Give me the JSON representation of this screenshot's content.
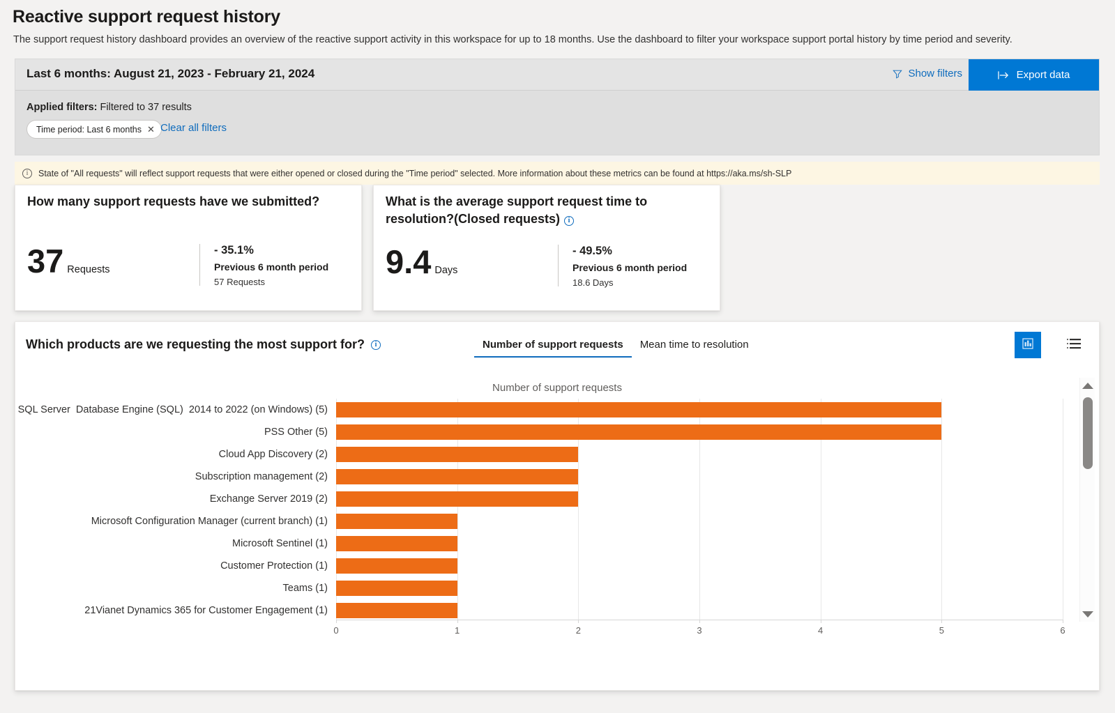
{
  "header": {
    "title": "Reactive support request history",
    "description": "The support request history dashboard provides an overview of the reactive support activity in this workspace for up to 18 months. Use the dashboard to filter your workspace support portal history by time period and severity."
  },
  "filter_panel": {
    "range_label": "Last 6 months: August 21, 2023 - February 21, 2024",
    "show_filters_label": "Show filters",
    "show_filters_icon": "funnel-icon",
    "export_label": "Export data",
    "export_icon": "export-arrow-icon",
    "applied_filters_label": "Applied filters:",
    "applied_filters_value": " Filtered to 37 results",
    "chip_label": "Time period: Last 6 months",
    "chip_close_icon": "close-icon",
    "clear_all_label": "Clear all filters"
  },
  "banner": {
    "icon": "info-icon",
    "text": "State of \"All requests\" will reflect support requests that were either opened or closed during the \"Time period\" selected. More information about these metrics can be found at https://aka.ms/sh-SLP"
  },
  "kpis": [
    {
      "title": "How many support requests have we submitted?",
      "value": "37",
      "unit": "Requests",
      "delta": "- 35.1%",
      "previous_label": "Previous 6 month period",
      "previous_value": "57 Requests",
      "has_info_icon": false
    },
    {
      "title_line1": "What is the average support request time to",
      "title_line2": "resolution?(Closed requests)",
      "value": "9.4",
      "unit": "Days",
      "delta": "- 49.5%",
      "previous_label": "Previous 6 month period",
      "previous_value": "18.6 Days",
      "has_info_icon": true,
      "info_icon": "info-icon"
    }
  ],
  "chart_card": {
    "question": "Which products are we requesting the most support for?",
    "question_info_icon": "info-icon",
    "tabs": [
      {
        "label": "Number of support requests",
        "active": true
      },
      {
        "label": "Mean time to resolution",
        "active": false
      }
    ],
    "view_buttons": [
      {
        "name": "chart-view-button",
        "icon": "bar-chart-icon",
        "active": true
      },
      {
        "name": "table-view-button",
        "icon": "list-view-icon",
        "active": false
      }
    ],
    "scrollbar": {
      "up_icon": "chevron-up-icon",
      "down_icon": "chevron-down-icon"
    }
  },
  "chart_data": {
    "type": "bar",
    "orientation": "horizontal",
    "title": "Number of support requests",
    "xlabel": "",
    "ylabel": "",
    "xlim": [
      0,
      6
    ],
    "xticks": [
      0,
      1,
      2,
      3,
      4,
      5,
      6
    ],
    "grid": true,
    "legend": "none",
    "bar_color": "#ed6c16",
    "categories": [
      "SQL Server  Database Engine (SQL)  2014 to 2022 (on Windows) (5)",
      "PSS Other (5)",
      "Cloud App Discovery (2)",
      "Subscription management (2)",
      "Exchange Server 2019 (2)",
      "Microsoft Configuration Manager (current branch) (1)",
      "Microsoft Sentinel (1)",
      "Customer Protection (1)",
      "Teams (1)",
      "21Vianet Dynamics 365 for Customer Engagement (1)"
    ],
    "values": [
      5,
      5,
      2,
      2,
      2,
      1,
      1,
      1,
      1,
      1
    ]
  },
  "colors": {
    "accent": "#0078d4",
    "link": "#0f6cbd",
    "bar": "#ed6c16",
    "banner_bg": "#fdf6e3",
    "page_bg": "#f3f2f1"
  }
}
